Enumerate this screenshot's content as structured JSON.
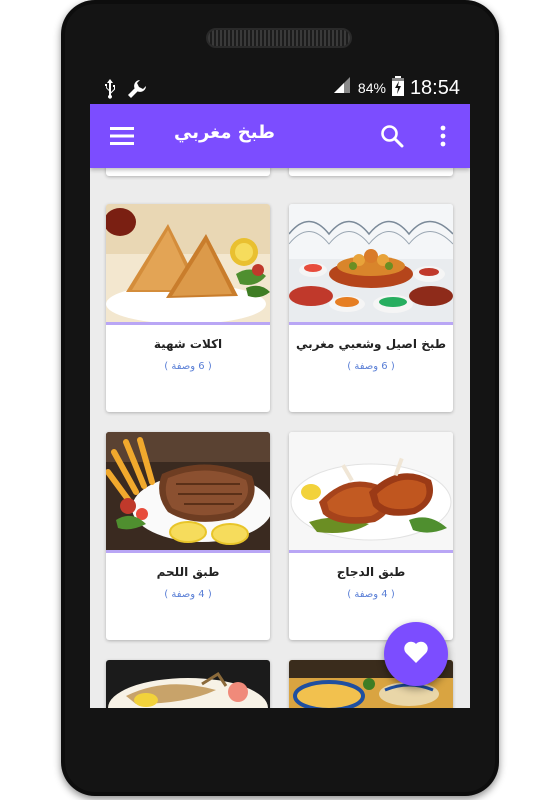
{
  "status_bar": {
    "battery_percent": "84%",
    "time": "18:54",
    "icons": [
      "usb-icon",
      "wrench-icon",
      "signal-icon",
      "battery-charging-icon"
    ]
  },
  "toolbar": {
    "title": "طبخ مغربي",
    "menu_icon": "hamburger-menu-icon",
    "search_icon": "search-icon",
    "more_icon": "more-vert-icon"
  },
  "categories": [
    {
      "title": "طبخ اصيل وشعبي مغربي",
      "count": "( 6 وصفة )",
      "image": "moroccan-feast-photo"
    },
    {
      "title": "اكلات شهية",
      "count": "( 6 وصفة )",
      "image": "samosa-photo"
    },
    {
      "title": "طبق الدجاج",
      "count": "( 4 وصفة )",
      "image": "roast-chicken-photo"
    },
    {
      "title": "طبق اللحم",
      "count": "( 4 وصفة )",
      "image": "steak-photo"
    }
  ],
  "fab": {
    "icon": "heart-icon"
  },
  "colors": {
    "primary": "#7c4dff",
    "divider": "#b9a6f5",
    "count_text": "#5a7fd6",
    "background": "#ececec"
  }
}
